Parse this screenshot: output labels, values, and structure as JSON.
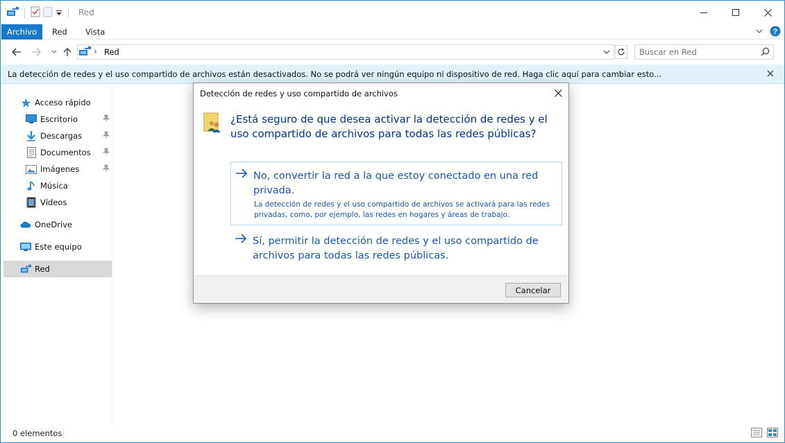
{
  "window": {
    "title": "Red"
  },
  "ribbon": {
    "tabs": [
      "Archivo",
      "Red",
      "Vista"
    ]
  },
  "address": {
    "location": "Red",
    "search_placeholder": "Buscar en Red"
  },
  "infobar": {
    "text": "La detección de redes y el uso compartido de archivos están desactivados. No se podrá ver ningún equipo ni dispositivo de red. Haga clic aquí para cambiar esto..."
  },
  "sidebar": {
    "quick_access": "Acceso rápido",
    "items": [
      {
        "label": "Escritorio",
        "icon": "desktop-icon"
      },
      {
        "label": "Descargas",
        "icon": "downloads-icon"
      },
      {
        "label": "Documentos",
        "icon": "documents-icon"
      },
      {
        "label": "Imágenes",
        "icon": "pictures-icon"
      },
      {
        "label": "Música",
        "icon": "music-icon"
      },
      {
        "label": "Vídeos",
        "icon": "videos-icon"
      }
    ],
    "onedrive": "OneDrive",
    "this_pc": "Este equipo",
    "network": "Red"
  },
  "status": {
    "items_count": "0 elementos"
  },
  "dialog": {
    "title": "Detección de redes y uso compartido de archivos",
    "question": "¿Está seguro de que desea activar la detección de redes y el uso compartido de archivos para todas las redes públicas?",
    "option_no_title": "No, convertir la red a la que estoy conectado en una red privada.",
    "option_no_desc": "La detección de redes y el uso compartido de archivos se activará para las redes privadas, como, por ejemplo, las redes en hogares y áreas de trabajo.",
    "option_yes_title": "Sí, permitir la detección de redes y el uso compartido de archivos para todas las redes públicas.",
    "cancel_label": "Cancelar"
  },
  "colors": {
    "accent": "#1979ca",
    "infobar_bg": "#e1f2fd",
    "link_blue": "#1a57b6",
    "question_blue": "#003399"
  }
}
